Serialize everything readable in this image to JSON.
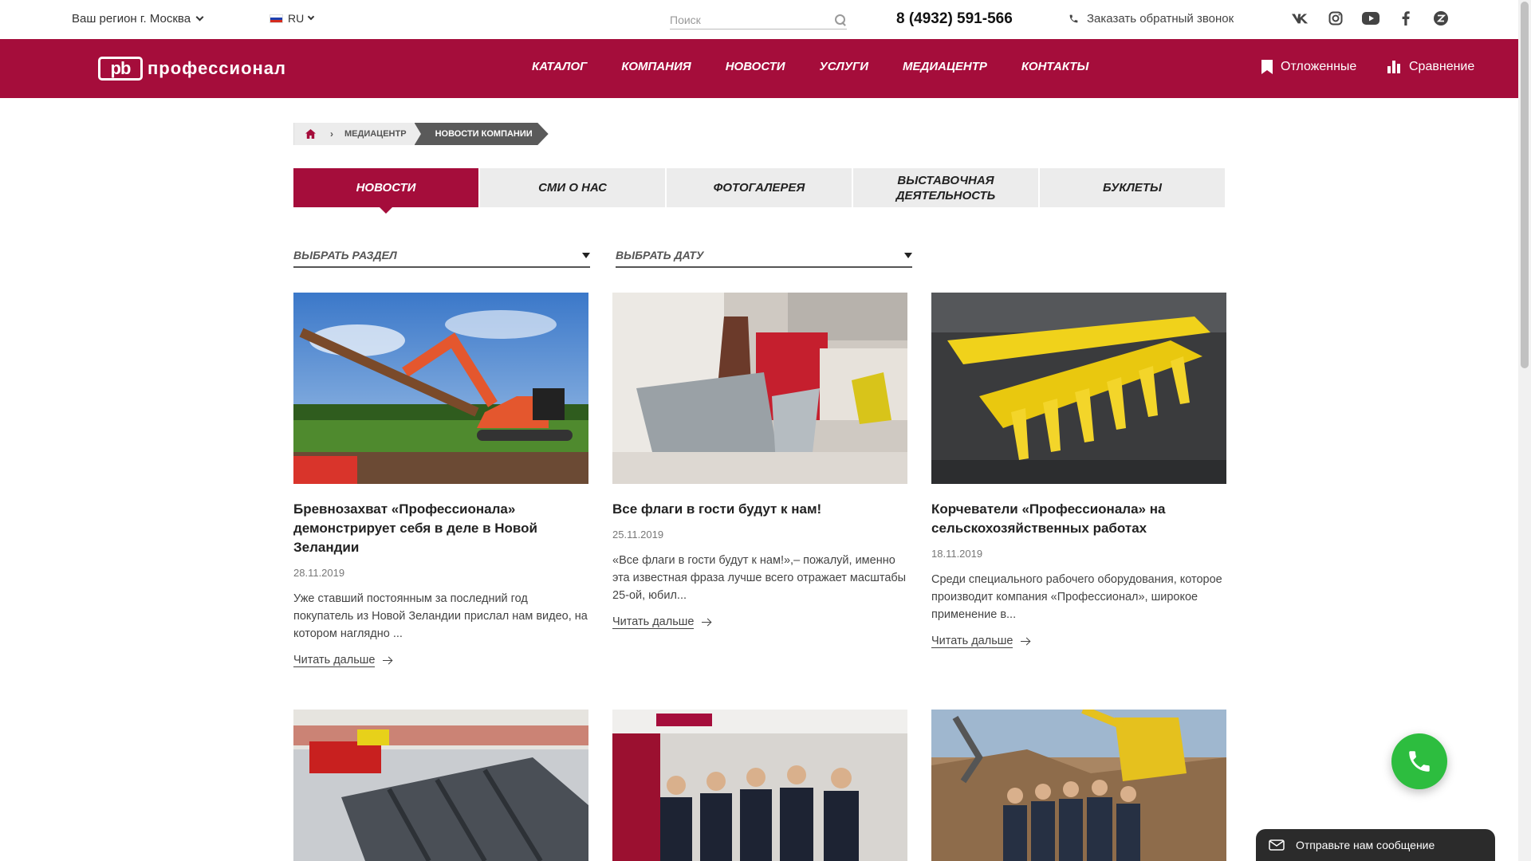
{
  "topbar": {
    "region": "Ваш регион г. Москва",
    "lang": "RU",
    "search_placeholder": "Поиск",
    "phone": "8 (4932) 591-566",
    "callback": "Заказать обратный звонок",
    "socials": [
      "vk-icon",
      "instagram-icon",
      "youtube-icon",
      "facebook-icon",
      "zen-icon"
    ]
  },
  "header": {
    "logo_mark": "pb",
    "logo_text": "профессионал",
    "nav": [
      "КАТАЛОГ",
      "КОМПАНИЯ",
      "НОВОСТИ",
      "УСЛУГИ",
      "МЕДИАЦЕНТР",
      "КОНТАКТЫ"
    ],
    "saved": "Отложенные",
    "compare": "Сравнение"
  },
  "breadcrumb": {
    "mid": "МЕДИАЦЕНТР",
    "current": "НОВОСТИ КОМПАНИИ"
  },
  "tabs": [
    "НОВОСТИ",
    "СМИ О НАС",
    "ФОТОГАЛЕРЕЯ",
    "ВЫСТАВОЧНАЯ ДЕЯТЕЛЬНОСТЬ",
    "БУКЛЕТЫ"
  ],
  "filters": {
    "section": "ВЫБРАТЬ РАЗДЕЛ",
    "date": "ВЫБРАТЬ ДАТУ"
  },
  "news": [
    {
      "title": "Бревнозахват «Профессионала» демонстрирует себя в деле в Новой Зеландии",
      "date": "28.11.2019",
      "excerpt": "Уже ставший постоянным за последний год покупатель из Новой Зеландии прислал нам видео, на котором наглядно ...",
      "more": "Читать дальше"
    },
    {
      "title": "Все флаги в гости будут к нам!",
      "date": "25.11.2019",
      "excerpt": "«Все флаги в гости будут к нам!»,– пожалуй, именно эта известная фраза лучше всего отражает масштабы 25-ой, юбил...",
      "more": "Читать дальше"
    },
    {
      "title": "Корчеватели «Профессионала» на сельскохозяйственных работах",
      "date": "18.11.2019",
      "excerpt": "Среди специального рабочего оборудования, которое производит компания «Профессионал», широкое применение в...",
      "more": "Читать дальше"
    }
  ],
  "chat": "Отправьте нам сообщение",
  "colors": {
    "brand": "#a50d3b",
    "call": "#2dbd3f"
  }
}
